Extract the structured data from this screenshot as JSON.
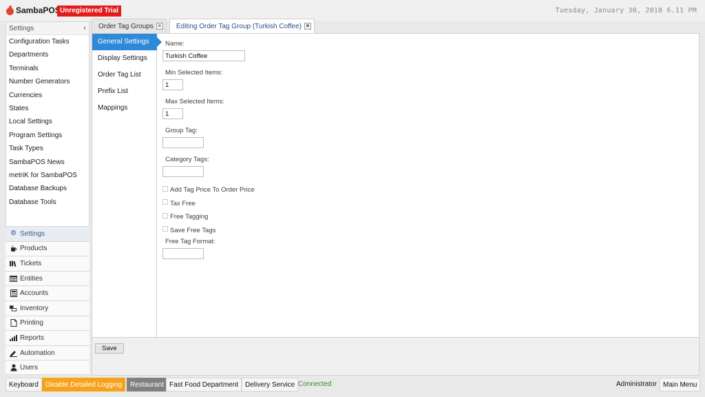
{
  "app": {
    "logo_text": "SambaPOS",
    "trial_badge": "Unregistered Trial",
    "datetime": "Tuesday, January 30, 2018 6.11 PM"
  },
  "settings_panel": {
    "header": "Settings",
    "items": [
      "Configuration Tasks",
      "Departments",
      "Terminals",
      "Number Generators",
      "Currencies",
      "States",
      "Local Settings",
      "Program Settings",
      "Task Types",
      "SambaPOS News",
      "metriK for SambaPOS",
      "Database Backups",
      "Database Tools"
    ]
  },
  "main_nav": [
    {
      "label": "Settings",
      "icon": "gear-icon",
      "active": true
    },
    {
      "label": "Products",
      "icon": "coffee-icon",
      "active": false
    },
    {
      "label": "Tickets",
      "icon": "tickets-icon",
      "active": false
    },
    {
      "label": "Entities",
      "icon": "entities-icon",
      "active": false
    },
    {
      "label": "Accounts",
      "icon": "calculator-icon",
      "active": false
    },
    {
      "label": "Inventory",
      "icon": "inventory-icon",
      "active": false
    },
    {
      "label": "Printing",
      "icon": "document-icon",
      "active": false
    },
    {
      "label": "Reports",
      "icon": "bar-chart-icon",
      "active": false
    },
    {
      "label": "Automation",
      "icon": "pencil-icon",
      "active": false
    },
    {
      "label": "Users",
      "icon": "user-icon",
      "active": false
    }
  ],
  "tabs": [
    {
      "label": "Order Tag Groups",
      "active": false
    },
    {
      "label": "Editing Order Tag Group (Turkish Coffee)",
      "active": true
    }
  ],
  "subnav": [
    {
      "label": "General Settings",
      "active": true
    },
    {
      "label": "Display Settings",
      "active": false
    },
    {
      "label": "Order Tag List",
      "active": false
    },
    {
      "label": "Prefix List",
      "active": false
    },
    {
      "label": "Mappings",
      "active": false
    }
  ],
  "form": {
    "name_label": "Name:",
    "name_value": "Turkish Coffee",
    "min_label": "Min Selected Items:",
    "min_value": "1",
    "max_label": "Max Selected Items:",
    "max_value": "1",
    "group_tag_label": "Group Tag:",
    "group_tag_value": "",
    "category_tags_label": "Category Tags:",
    "category_tags_value": "",
    "checkboxes": [
      {
        "label": "Add Tag Price To Order Price",
        "checked": false
      },
      {
        "label": "Tax Free",
        "checked": false
      },
      {
        "label": "Free Tagging",
        "checked": false
      },
      {
        "label": "Save Free Tags",
        "checked": false
      }
    ],
    "free_tag_format_label": "Free Tag Format:",
    "free_tag_format_value": "",
    "save_label": "Save"
  },
  "status_bar": {
    "keyboard": "Keyboard",
    "logging": "Disable Detailed Logging",
    "restaurant": "Restaurant",
    "department": "Fast Food Department",
    "delivery": "Delivery Service",
    "connected": "Connected",
    "user": "Administrator",
    "main_menu": "Main Menu"
  },
  "colors": {
    "accent": "#2e8ad8",
    "trial_red": "#e21b1b",
    "logging_orange": "#f7a21b",
    "connected_green": "#3c8c28"
  }
}
